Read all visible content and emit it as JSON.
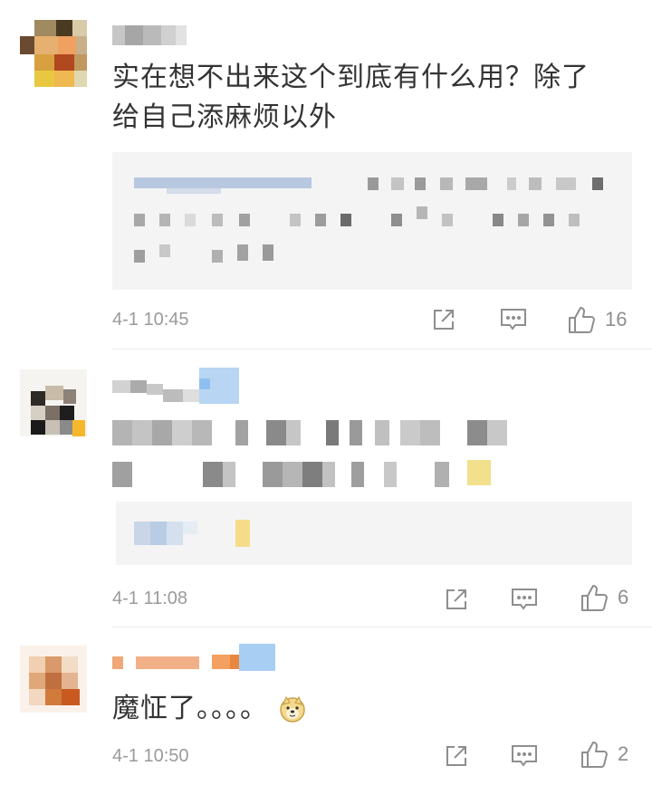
{
  "comments": [
    {
      "text_line1": "实在想不出来这个到底有什么用？除了",
      "text_line2": "给自己添麻烦以外",
      "time": "4-1 10:45",
      "likes": "16"
    },
    {
      "time": "4-1 11:08",
      "likes": "6"
    },
    {
      "text": "魔怔了。。。。",
      "time": "4-1 10:50",
      "likes": "2"
    }
  ],
  "icons": {
    "share": "share-icon",
    "reply": "reply-icon",
    "like": "thumbs-up-icon"
  },
  "colors": {
    "text": "#333333",
    "meta": "#9a9a9a",
    "quote_bg": "#f4f4f4",
    "divider": "#ececec"
  }
}
